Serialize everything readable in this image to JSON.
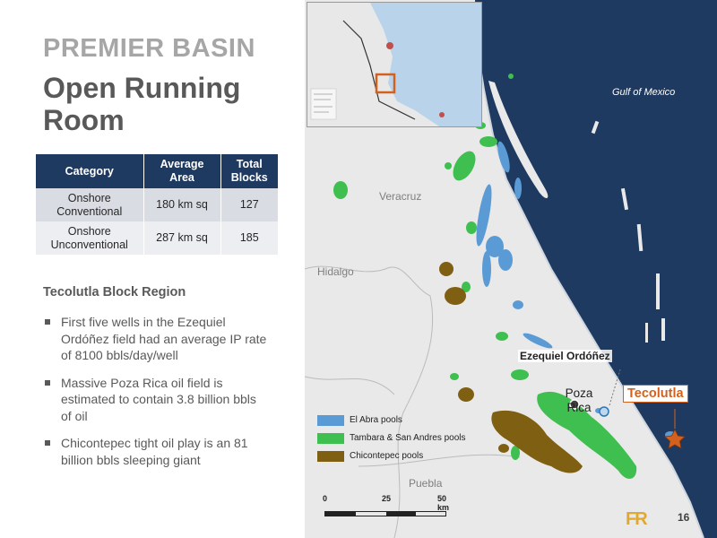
{
  "title": {
    "line1": "PREMIER BASIN",
    "line2": "Open Running Room"
  },
  "table": {
    "headers": [
      "Category",
      "Average Area",
      "Total Blocks"
    ],
    "rows": [
      {
        "category": "Onshore Conventional",
        "area": "180 km sq",
        "blocks": "127"
      },
      {
        "category": "Onshore Unconventional",
        "area": "287 km sq",
        "blocks": "185"
      }
    ]
  },
  "section_title": "Tecolutla Block Region",
  "bullets": [
    "First five wells in the Ezequiel Ordóñez field had an average IP rate of 8100 bbls/day/well",
    "Massive Poza Rica oil field is estimated to contain 3.8 billion bbls of oil",
    "Chicontepec tight oil play is an 81 billion bbls sleeping giant"
  ],
  "map": {
    "sea_label": "Gulf of Mexico",
    "region_labels": {
      "veracruz": "Veracruz",
      "hidalgo": "Hidalgo",
      "puebla": "Puebla"
    },
    "field_label": "Ezequiel Ordóñez",
    "city_label": "Poza Rica",
    "block_label": "Tecolutla",
    "legend": [
      {
        "label": "El Abra pools",
        "color": "#5b9bd5"
      },
      {
        "label": "Tambara & San Andres pools",
        "color": "#3fbf4f"
      },
      {
        "label": "Chicontepec pools",
        "color": "#7f5f12"
      }
    ],
    "scale": {
      "ticks": [
        "0",
        "25",
        "50 km"
      ]
    },
    "colors": {
      "sea": "#1f3a60",
      "land": "#e9e9e9",
      "marker": "#d2611d"
    }
  },
  "logo": "FR",
  "page_number": "16"
}
